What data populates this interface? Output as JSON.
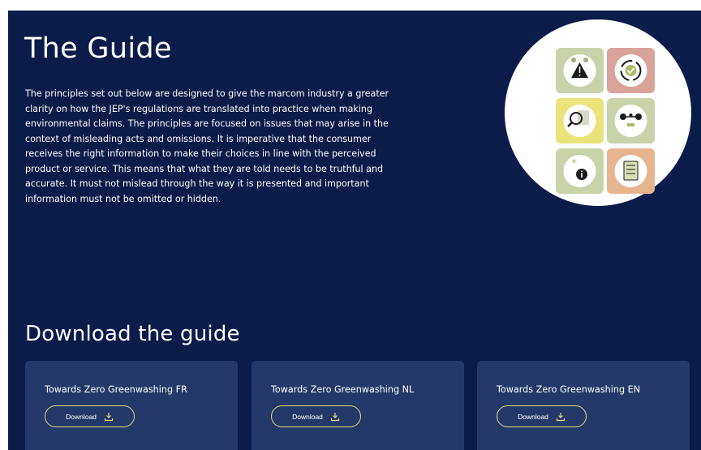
{
  "hero": {
    "title": "The Guide",
    "intro": "The principles set out below are designed to give the marcom industry a greater clarity on how the JEP's regulations are translated into practice when making environmental claims. The principles are focused on issues that may arise in the context of misleading acts and omissions. It is imperative that the consumer receives the right information to make their choices in line with the perceived product or service. This means that what they are told needs to be truthful and accurate. It must not mislead through the way it is presented and important information must not be omitted or hidden."
  },
  "illustration": {
    "tiles": [
      {
        "icon": "warning-icon",
        "color": "#c9d3a9"
      },
      {
        "icon": "cycle-check-icon",
        "color": "#d9a39a"
      },
      {
        "icon": "magnifier-icon",
        "color": "#e9e37c"
      },
      {
        "icon": "balance-scale-icon",
        "color": "#c9d3a9"
      },
      {
        "icon": "info-asterisk-icon",
        "color": "#c9d3a9"
      },
      {
        "icon": "checklist-icon",
        "color": "#e6b48e"
      }
    ]
  },
  "download": {
    "heading": "Download the guide",
    "cards": [
      {
        "title": "Towards Zero Greenwashing FR",
        "button_label": "Download",
        "icon": "download-icon"
      },
      {
        "title": "Towards Zero Greenwashing NL",
        "button_label": "Download",
        "icon": "download-icon"
      },
      {
        "title": "Towards Zero Greenwashing EN",
        "button_label": "Download",
        "icon": "download-icon"
      }
    ]
  },
  "colors": {
    "background": "#0b1c4a",
    "card": "#24396a",
    "button_border": "#e8d97a"
  }
}
